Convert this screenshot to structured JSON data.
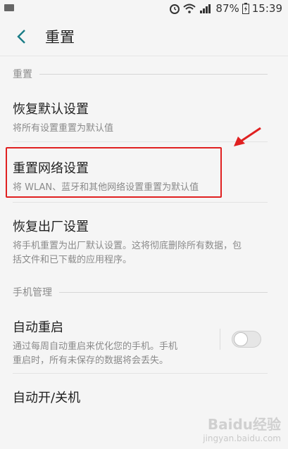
{
  "status_bar": {
    "battery": "87%",
    "time": "15:39",
    "icons": [
      "alarm-icon",
      "wifi-icon",
      "signal-icon",
      "battery-icon"
    ]
  },
  "app_bar": {
    "title": "重置"
  },
  "section_reset": {
    "header": "重置",
    "items": [
      {
        "title": "恢复默认设置",
        "subtitle": "将所有设置重置为默认值"
      },
      {
        "title": "重置网络设置",
        "subtitle": "将 WLAN、蓝牙和其他网络设置重置为默认值"
      },
      {
        "title": "恢复出厂设置",
        "subtitle_line1": "将手机重置为出厂默认设置。这将彻底删除所有数据，包",
        "subtitle_line2": "括文件和已下载的应用程序。"
      }
    ]
  },
  "section_manage": {
    "header": "手机管理",
    "auto_restart": {
      "title": "自动重启",
      "subtitle_line1": "通过每周自动重启来优化您的手机。手机",
      "subtitle_line2": "重启时，所有未保存的数据将会丢失。",
      "enabled": false
    },
    "auto_power": {
      "title": "自动开/关机"
    }
  },
  "watermark": {
    "brand": "Baidu经验",
    "url": "jingyan.baidu.com"
  },
  "colors": {
    "highlight": "#e02020",
    "accent": "#1a7c86"
  }
}
